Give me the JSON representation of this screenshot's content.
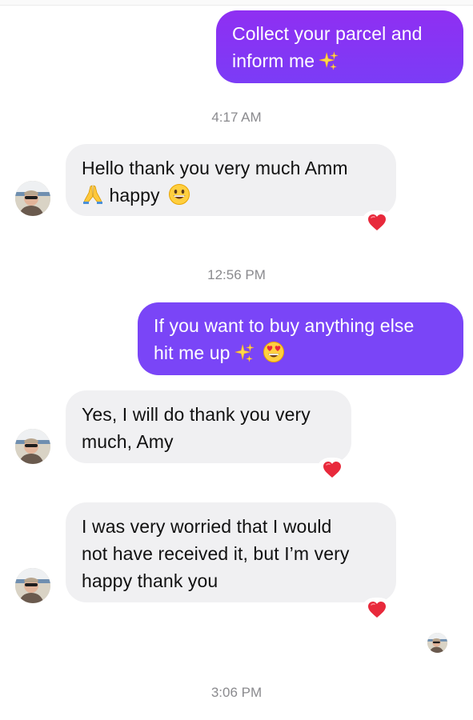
{
  "colors": {
    "outgoing_gradient_top": "#8f2ff2",
    "outgoing_gradient_bottom": "#7b3cf6",
    "outgoing_second": "#7a45f7",
    "incoming_bg": "#f0f0f2",
    "timestamp": "#8a8a8e",
    "heart": "#e8293b"
  },
  "messages": [
    {
      "direction": "outgoing",
      "text": "Collect your parcel and\ninform me",
      "emoji": [
        "sparkles-icon"
      ]
    },
    {
      "timestamp": "4:17 AM"
    },
    {
      "direction": "incoming",
      "text": "Hello thank you very much Amm",
      "text2": " happy",
      "emoji": [
        "folded-hands-icon",
        "grinning-face-icon"
      ],
      "reaction": "heart-icon"
    },
    {
      "timestamp": "12:56 PM"
    },
    {
      "direction": "outgoing",
      "text": "If you want to buy anything else\nhit me up",
      "emoji": [
        "sparkles-icon",
        "heart-eyes-face-icon"
      ]
    },
    {
      "direction": "incoming",
      "text": "Yes, I will do thank you very\nmuch, Amy",
      "reaction": "heart-icon"
    },
    {
      "direction": "incoming",
      "text": "I was very worried that I would\nnot have received it, but I’m very\nhappy thank you",
      "reaction": "heart-icon"
    },
    {
      "read_receipt": "avatar"
    },
    {
      "timestamp": "3:06 PM"
    }
  ],
  "ui": {
    "msg1": "Collect your parcel and\ninform me",
    "ts1": "4:17 AM",
    "msg2_line1": "Hello thank you very much Amm",
    "msg2_line2": " happy",
    "ts2": "12:56 PM",
    "msg3": "If you want to buy anything else\nhit me up",
    "msg4": "Yes, I will do thank you very\nmuch, Amy",
    "msg5": "I was very worried that I would\nnot have received it, but I’m very\nhappy thank you",
    "ts3": "3:06 PM"
  }
}
